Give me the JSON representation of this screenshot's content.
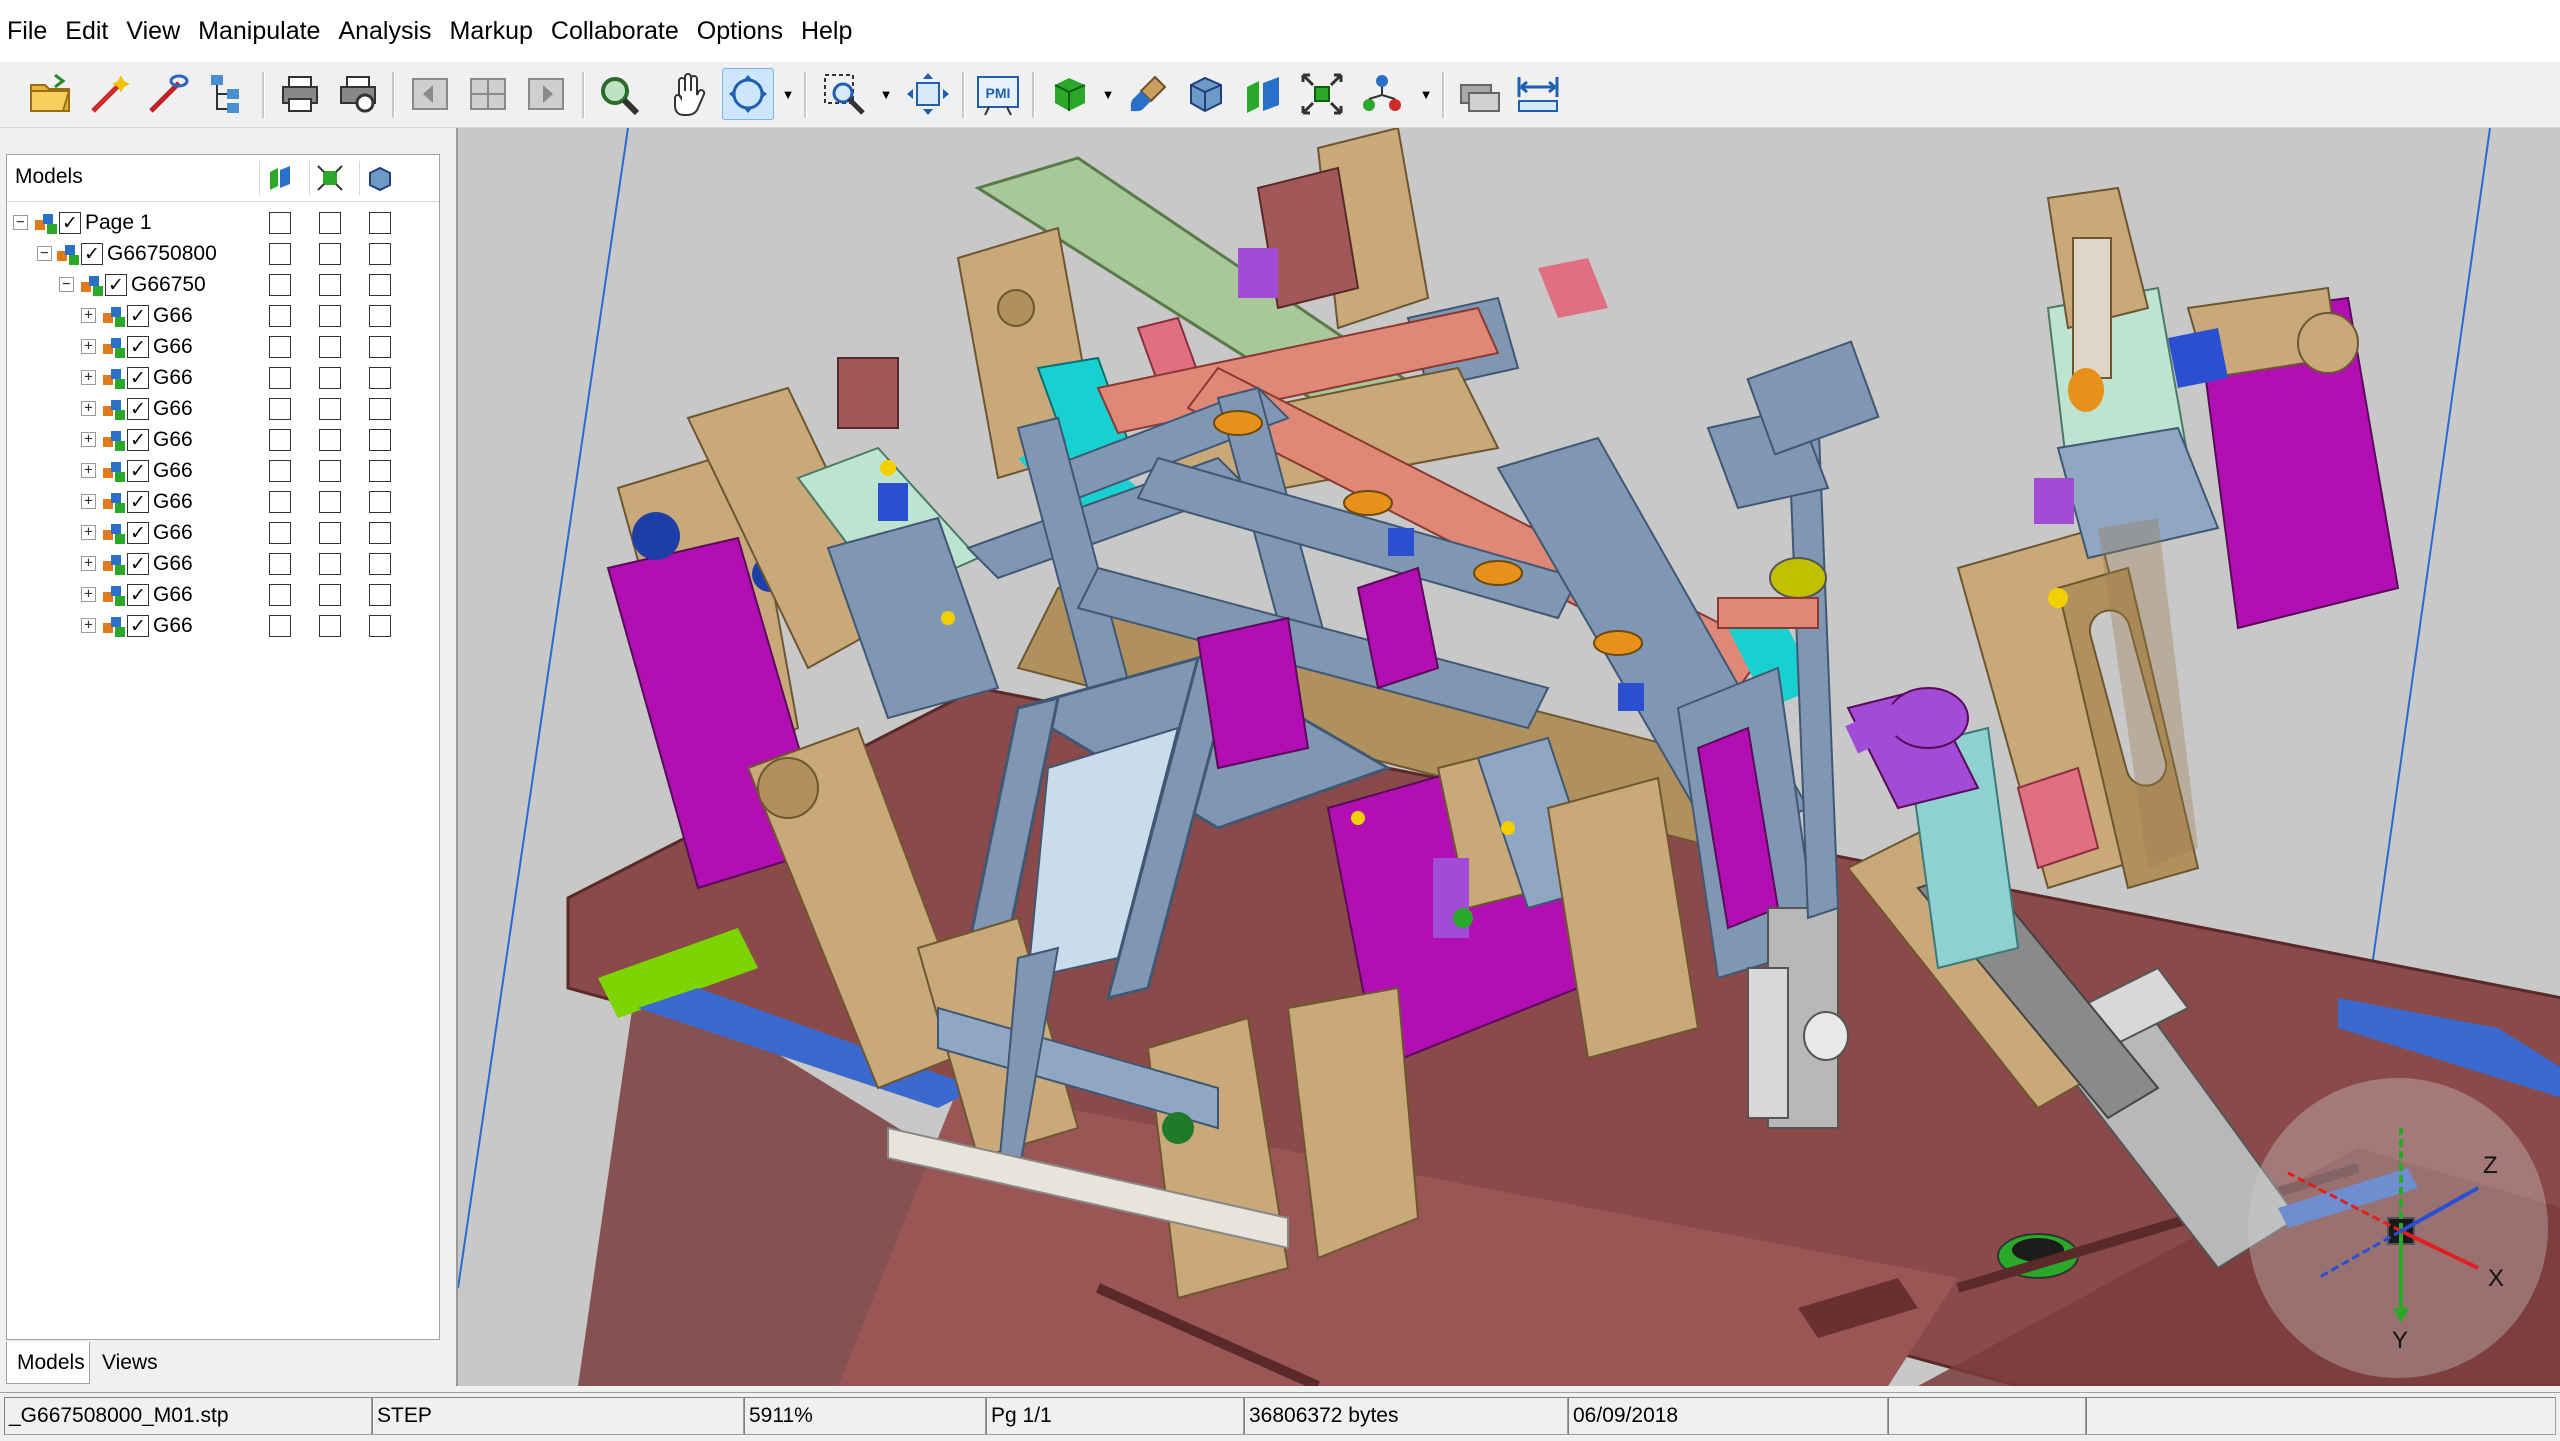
{
  "menu": [
    "File",
    "Edit",
    "View",
    "Manipulate",
    "Analysis",
    "Markup",
    "Collaborate",
    "Options",
    "Help"
  ],
  "toolbar": {
    "icons": [
      "open-folder-icon",
      "wand-icon",
      "wand-alt-icon",
      "tree-structure-icon",
      "print-icon",
      "print-preview-icon",
      "page-first-icon",
      "page-grid-icon",
      "page-last-icon",
      "zoom-search-icon",
      "pan-hand-icon",
      "rotate-icon",
      "zoom-box-icon",
      "fit-view-icon",
      "pmi-icon",
      "shaded-cube-icon",
      "paint-brush-icon",
      "wireframe-cube-icon",
      "section-icon",
      "explode-icon",
      "assembly-icon",
      "measure-icon",
      "dimension-icon"
    ],
    "pmi_label": "PMI"
  },
  "model_tree": {
    "header_label": "Models",
    "column_icons": [
      "visibility-column-icon",
      "attribute-column-icon",
      "transparency-column-icon"
    ],
    "rows": [
      {
        "label": "Page 1",
        "level": 0,
        "checked": true,
        "expander": "−"
      },
      {
        "label": "G66750800",
        "level": 1,
        "checked": true,
        "expander": "−"
      },
      {
        "label": "G66750",
        "level": 2,
        "checked": true,
        "expander": "−"
      },
      {
        "label": "G66",
        "level": 3,
        "checked": true,
        "expander": "+"
      },
      {
        "label": "G66",
        "level": 3,
        "checked": true,
        "expander": "+"
      },
      {
        "label": "G66",
        "level": 3,
        "checked": true,
        "expander": "+"
      },
      {
        "label": "G66",
        "level": 3,
        "checked": true,
        "expander": "+"
      },
      {
        "label": "G66",
        "level": 3,
        "checked": true,
        "expander": "+"
      },
      {
        "label": "G66",
        "level": 3,
        "checked": true,
        "expander": "+"
      },
      {
        "label": "G66",
        "level": 3,
        "checked": true,
        "expander": "+"
      },
      {
        "label": "G66",
        "level": 3,
        "checked": true,
        "expander": "+"
      },
      {
        "label": "G66",
        "level": 3,
        "checked": true,
        "expander": "+"
      },
      {
        "label": "G66",
        "level": 3,
        "checked": true,
        "expander": "+"
      },
      {
        "label": "G66",
        "level": 3,
        "checked": true,
        "expander": "+"
      }
    ]
  },
  "panel_tabs": [
    {
      "label": "Models",
      "active": true
    },
    {
      "label": "Views",
      "active": false
    }
  ],
  "axis_triad": {
    "x": "X",
    "y": "Y",
    "z": "Z"
  },
  "status_bar": {
    "filename": "_G667508000_M01.stp",
    "format": "STEP",
    "zoom": "5911%",
    "page": "Pg 1/1",
    "size": "36806372 bytes",
    "date": "06/09/2018",
    "progress": "",
    "extra": ""
  },
  "colors": {
    "viewport_bg": "#c8c8c8",
    "base_plate": "#8b4a4a",
    "tan_parts": "#c9a97a",
    "frame_blue": "#7f97b3",
    "magenta": "#b10fb1",
    "purple": "#a14bd6"
  }
}
